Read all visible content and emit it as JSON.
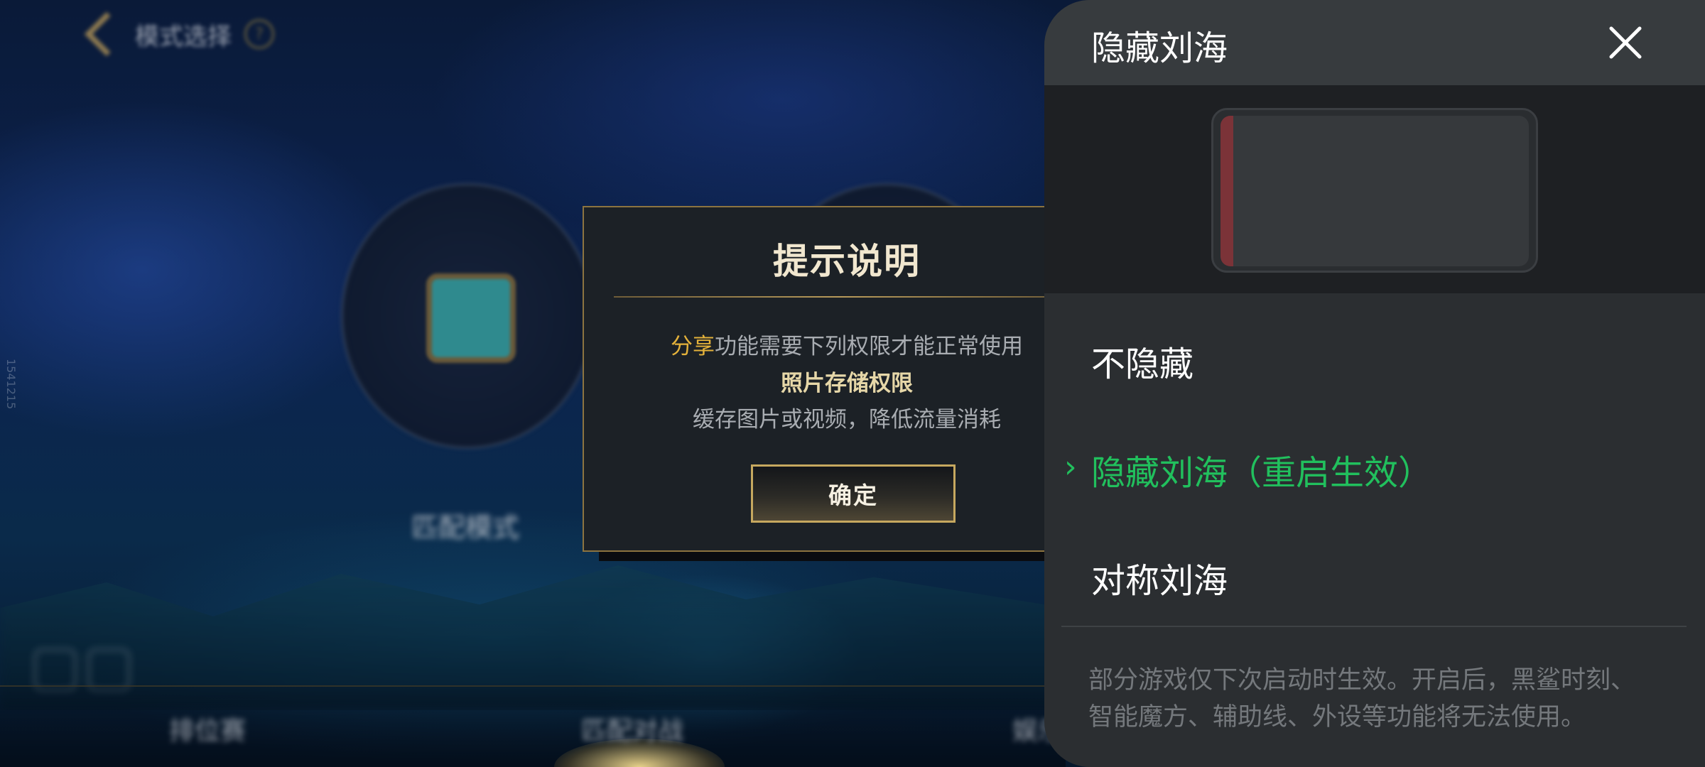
{
  "background": {
    "top_nav_title": "模式选择",
    "help_icon": "?",
    "mode_label": "匹配模式",
    "side_text": "1541215",
    "bottom_tabs": [
      "排位赛",
      "匹配对战",
      "娱乐"
    ]
  },
  "dialog": {
    "title": "提示说明",
    "line1_highlight": "分享",
    "line1_rest": "功能需要下列权限才能正常使用",
    "line2": "照片存储权限",
    "line3": "缓存图片或视频，降低流量消耗",
    "confirm_label": "确定"
  },
  "panel": {
    "title": "隐藏刘海",
    "options": [
      {
        "label": "不隐藏",
        "selected": false
      },
      {
        "label": "隐藏刘海（重启生效）",
        "selected": true
      },
      {
        "label": "对称刘海",
        "selected": false
      }
    ],
    "note_line1": "部分游戏仅下次启动时生效。开启后，黑鲨时刻、",
    "note_line2": "智能魔方、辅助线、外设等功能将无法使用。",
    "selected_arrow": "›",
    "colors": {
      "accent_green": "#21c05d",
      "notch_red": "#7b3338",
      "dialog_gold": "#c6a85f"
    }
  }
}
